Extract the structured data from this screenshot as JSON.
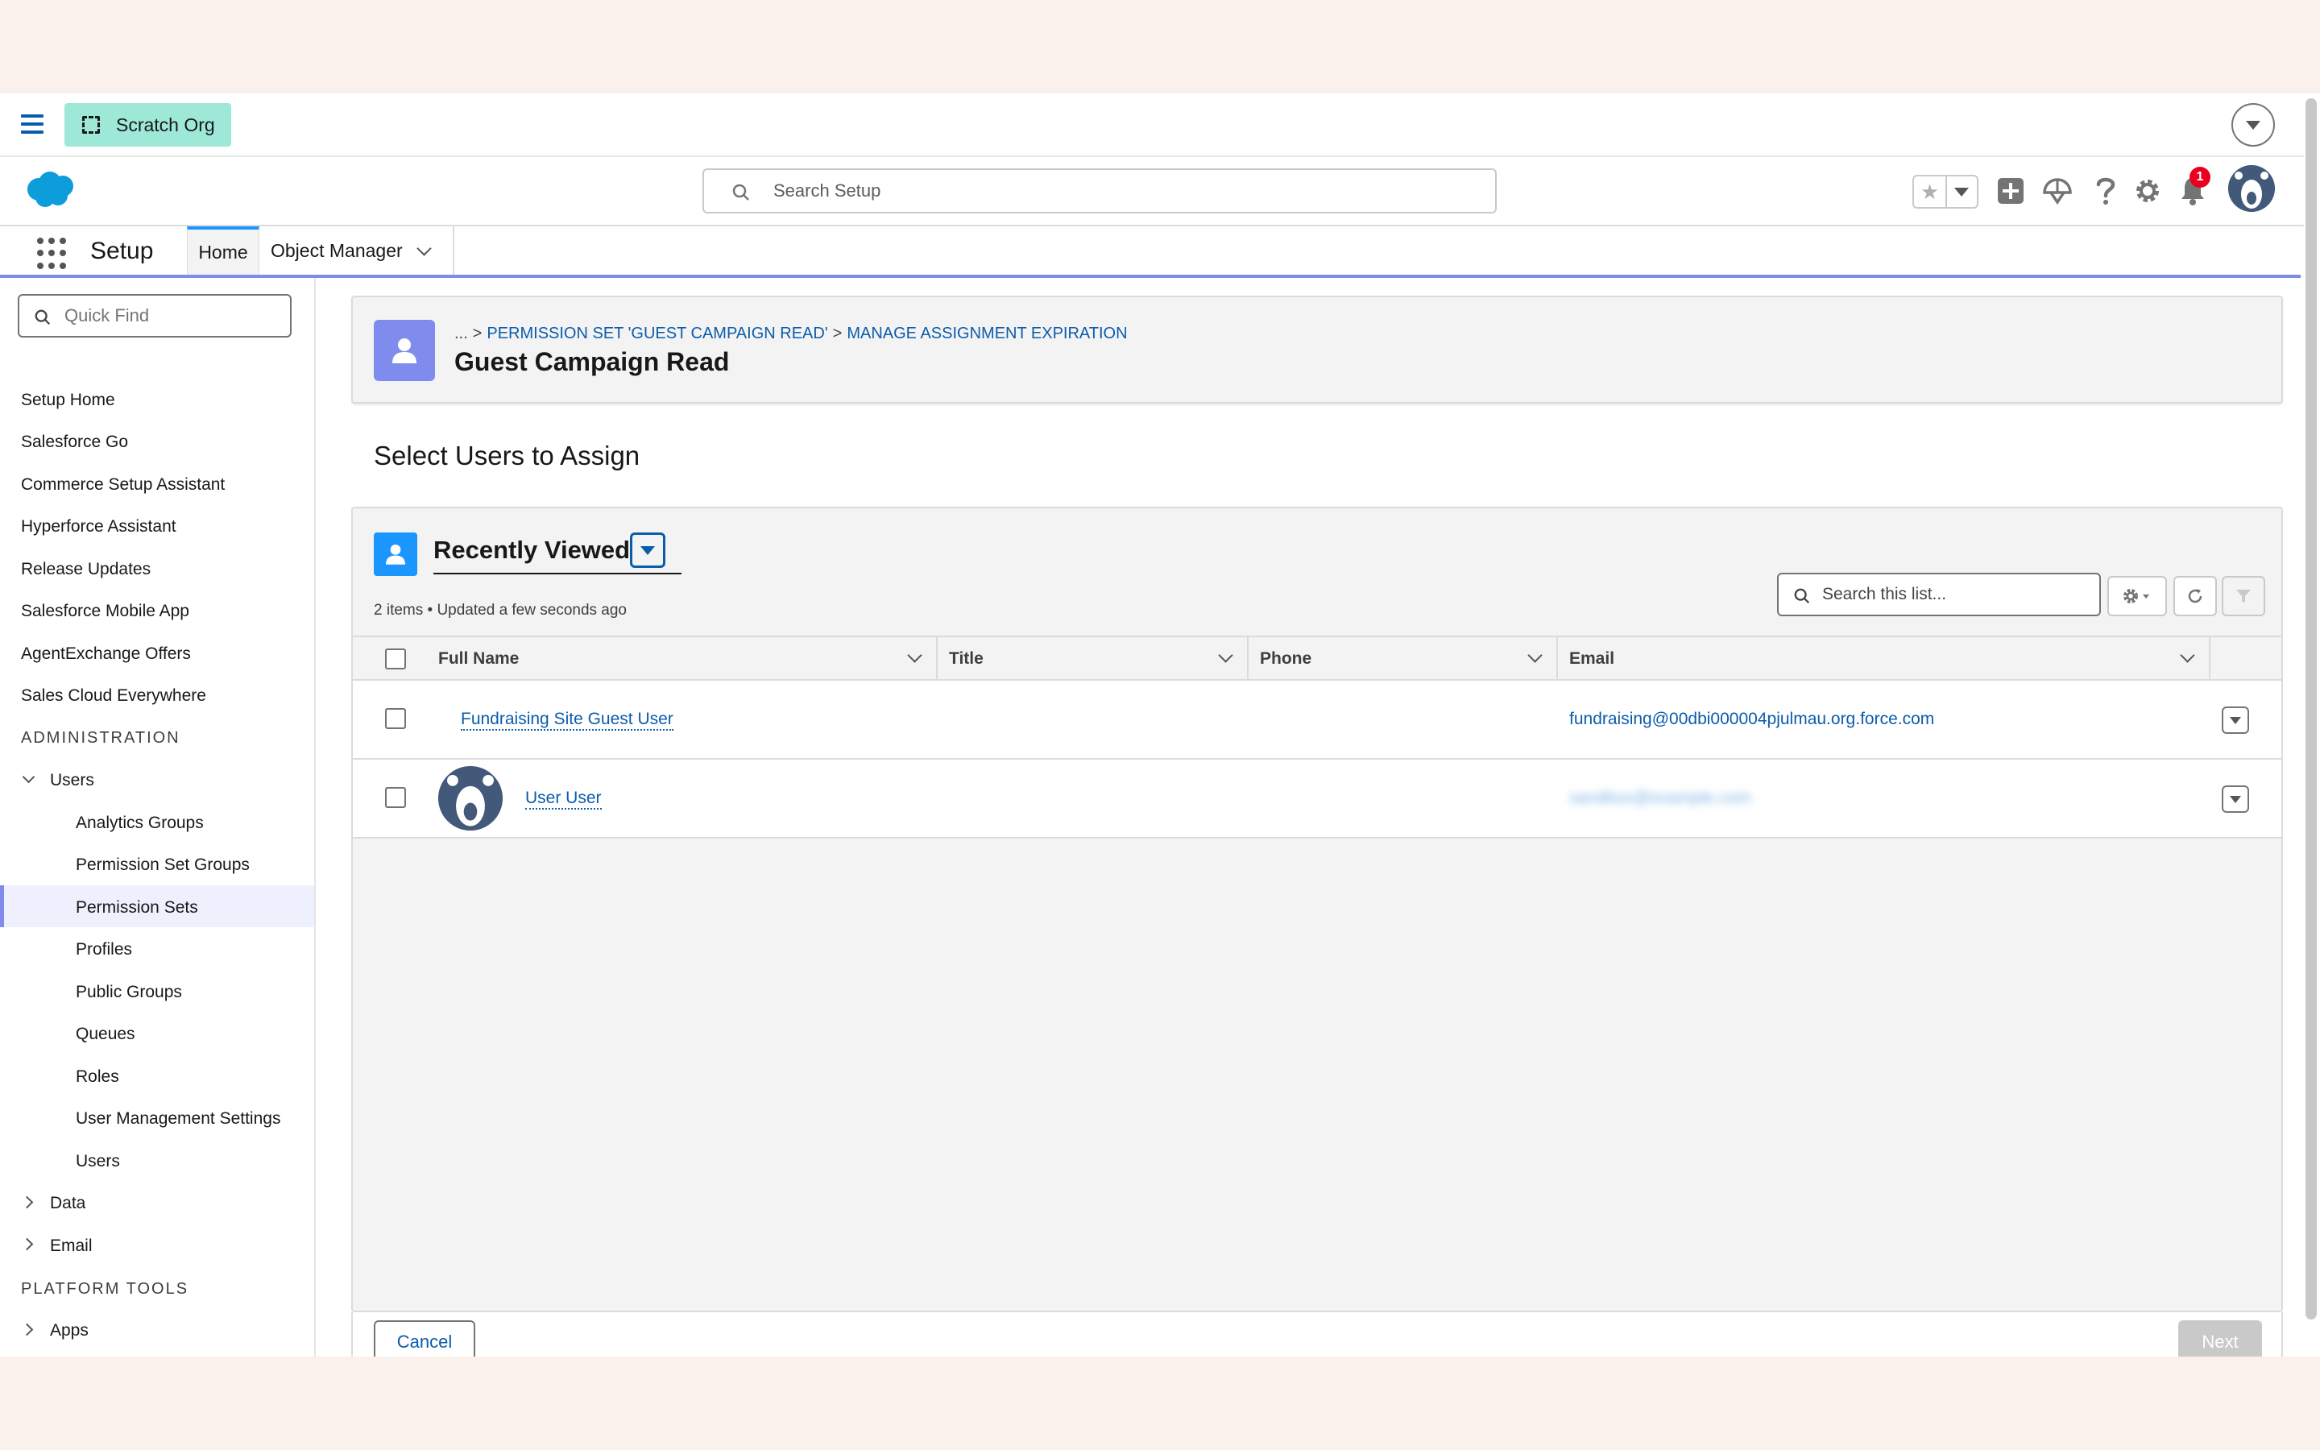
{
  "topbar": {
    "org_badge": "Scratch Org"
  },
  "header": {
    "search_placeholder": "Search Setup",
    "notification_count": "1"
  },
  "context": {
    "app_name": "Setup",
    "tabs": [
      {
        "label": "Home",
        "active": true
      },
      {
        "label": "Object Manager",
        "active": false
      }
    ]
  },
  "sidebar": {
    "quick_find_placeholder": "Quick Find",
    "items": [
      "Setup Home",
      "Salesforce Go",
      "Commerce Setup Assistant",
      "Hyperforce Assistant",
      "Release Updates",
      "Salesforce Mobile App",
      "AgentExchange Offers",
      "Sales Cloud Everywhere"
    ],
    "administration_heading": "ADMINISTRATION",
    "users_group": {
      "label": "Users",
      "children": [
        "Analytics Groups",
        "Permission Set Groups",
        "Permission Sets",
        "Profiles",
        "Public Groups",
        "Queues",
        "Roles",
        "User Management Settings",
        "Users"
      ],
      "active_child": "Permission Sets"
    },
    "collapsed_groups": [
      "Data",
      "Email"
    ],
    "platform_tools_heading": "PLATFORM TOOLS",
    "platform_groups": [
      "Apps"
    ]
  },
  "page": {
    "breadcrumb": {
      "ellipsis": "...",
      "crumb1": "PERMISSION SET 'GUEST CAMPAIGN READ'",
      "crumb2": "MANAGE ASSIGNMENT EXPIRATION"
    },
    "title": "Guest Campaign Read",
    "section_heading": "Select Users to Assign"
  },
  "list_view": {
    "title": "Recently Viewed",
    "meta": "2 items • Updated a few seconds ago",
    "search_placeholder": "Search this list...",
    "columns": [
      "Full Name",
      "Title",
      "Phone",
      "Email"
    ],
    "rows": [
      {
        "full_name": "Fundraising Site Guest User",
        "title": "",
        "phone": "",
        "email": "fundraising@00dbi000004pjulmau.org.force.com",
        "has_avatar": false
      },
      {
        "full_name": "User User",
        "title": "",
        "phone": "",
        "email": "sandbox@example.com",
        "email_blurred": true,
        "has_avatar": true
      }
    ]
  },
  "footer": {
    "cancel_label": "Cancel",
    "next_label": "Next"
  },
  "colors": {
    "brand_blue": "#0b5cab",
    "accent_purple": "#7f8ced",
    "list_icon_blue": "#1b96ff",
    "org_badge_bg": "#9ee8d8",
    "notification_red": "#ea001e"
  }
}
